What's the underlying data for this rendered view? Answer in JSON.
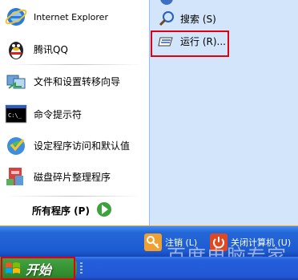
{
  "pinned": [
    {
      "label": "Internet Explorer",
      "icon": "internet-explorer-icon"
    },
    {
      "label": "腾讯QQ",
      "icon": "qq-penguin-icon"
    }
  ],
  "recent": [
    {
      "label": "文件和设置转移向导",
      "icon": "transfer-wizard-icon"
    },
    {
      "label": "命令提示符",
      "icon": "command-prompt-icon"
    },
    {
      "label": "设定程序访问和默认值",
      "icon": "program-defaults-icon"
    },
    {
      "label": "磁盘碎片整理程序",
      "icon": "defragmenter-icon"
    }
  ],
  "all_programs": {
    "label": "所有程序 (P)"
  },
  "right_pane": [
    {
      "label": "搜索 (S)",
      "icon": "search-icon"
    },
    {
      "label": "运行 (R)...",
      "icon": "run-icon"
    }
  ],
  "bottom": {
    "logoff_label": "注销 (L)",
    "shutdown_label": "关闭计算机 (U)"
  },
  "taskbar": {
    "start_label": "开始"
  },
  "watermark": "百度电脑专家",
  "colors": {
    "highlight": "#e00010",
    "right_pane_bg": "#d3e5fa",
    "bar_blue": "#245edb",
    "start_green": "#3c9a3a"
  }
}
